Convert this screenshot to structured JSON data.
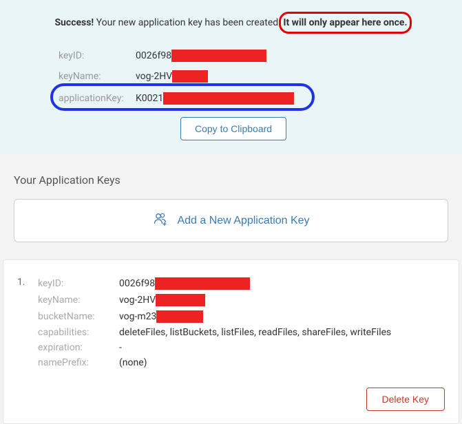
{
  "success": {
    "prefix": "Success!",
    "message": " Your new application key has been created.",
    "warning": "It will only appear here once."
  },
  "newKey": {
    "labels": {
      "keyID": "keyID:",
      "keyName": "keyName:",
      "applicationKey": "applicationKey:"
    },
    "values": {
      "keyID_prefix": "0026f98",
      "keyName_prefix": "vog-2HV",
      "applicationKey_prefix": "K0021"
    },
    "copyButton": "Copy to Clipboard"
  },
  "sectionTitle": "Your Application Keys",
  "addButton": "Add a New Application Key",
  "keyEntry": {
    "num": "1.",
    "labels": {
      "keyID": "keyID:",
      "keyName": "keyName:",
      "bucketName": "bucketName:",
      "capabilities": "capabilities:",
      "expiration": "expiration:",
      "namePrefix": "namePrefix:"
    },
    "values": {
      "keyID_prefix": "0026f98",
      "keyName_prefix": "vog-2HV",
      "bucketName_prefix": "vog-m23",
      "capabilities": "deleteFiles, listBuckets, listFiles, readFiles, shareFiles, writeFiles",
      "expiration": "-",
      "namePrefix": "(none)"
    },
    "deleteButton": "Delete Key"
  }
}
